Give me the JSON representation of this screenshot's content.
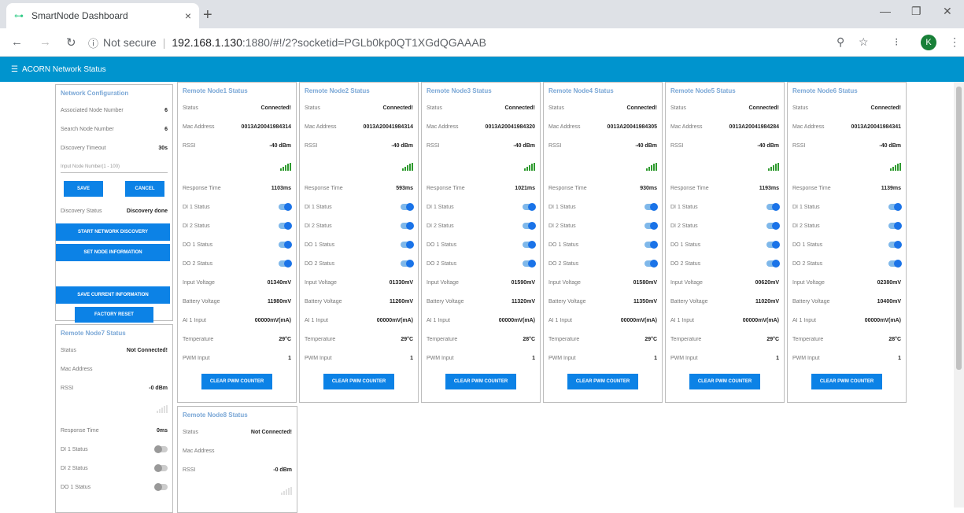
{
  "browser": {
    "tab_title": "SmartNode Dashboard",
    "tab_close": "×",
    "new_tab": "+",
    "not_secure": "Not secure",
    "url_host": "192.168.1.130",
    "url_rest": ":1880/#!/2?socketid=PGLb0kp0QT1XGdQGAAAB",
    "avatar_letter": "K"
  },
  "app": {
    "title": "ACORN Network Status",
    "menu_glyph": "☰"
  },
  "config": {
    "title": "Network Configuration",
    "rows": [
      {
        "label": "Associated Node Number",
        "value": "6"
      },
      {
        "label": "Search Node Number",
        "value": "6"
      },
      {
        "label": "Discovery Timeout",
        "value": "30s"
      }
    ],
    "input_placeholder": "Input Node Number(1 - 100)",
    "save": "SAVE",
    "cancel": "CANCEL",
    "discovery_label": "Discovery Status",
    "discovery_value": "Discovery done",
    "start_discovery": "START NETWORK DISCOVERY",
    "set_node_info": "SET NODE INFORMATION",
    "save_current": "SAVE CURRENT INFORMATION",
    "factory_reset": "FACTORY RESET"
  },
  "labels": {
    "status": "Status",
    "mac": "Mac Address",
    "rssi": "RSSI",
    "response": "Response Time",
    "di1": "DI 1 Status",
    "di2": "DI 2 Status",
    "do1": "DO 1 Status",
    "do2": "DO 2 Status",
    "input_v": "Input Voltage",
    "battery_v": "Battery Voltage",
    "ai1": "AI 1 Input",
    "temp": "Temperature",
    "pwm": "PWM Input",
    "clear_pwm": "CLEAR PWM COUNTER"
  },
  "nodes": [
    {
      "title": "Remote Node1 Status",
      "status": "Connected!",
      "mac": "0013A20041984314",
      "rssi": "-40 dBm",
      "response": "1103ms",
      "input_v": "01340mV",
      "battery_v": "11980mV",
      "ai1": "00000mV(mA)",
      "temp": "29°C",
      "pwm": "1"
    },
    {
      "title": "Remote Node2 Status",
      "status": "Connected!",
      "mac": "0013A20041984314",
      "rssi": "-40 dBm",
      "response": "593ms",
      "input_v": "01330mV",
      "battery_v": "11260mV",
      "ai1": "00000mV(mA)",
      "temp": "29°C",
      "pwm": "1"
    },
    {
      "title": "Remote Node3 Status",
      "status": "Connected!",
      "mac": "0013A20041984320",
      "rssi": "-40 dBm",
      "response": "1021ms",
      "input_v": "01590mV",
      "battery_v": "11320mV",
      "ai1": "00000mV(mA)",
      "temp": "28°C",
      "pwm": "1"
    },
    {
      "title": "Remote Node4 Status",
      "status": "Connected!",
      "mac": "0013A20041984305",
      "rssi": "-40 dBm",
      "response": "930ms",
      "input_v": "01580mV",
      "battery_v": "11350mV",
      "ai1": "00000mV(mA)",
      "temp": "29°C",
      "pwm": "1"
    },
    {
      "title": "Remote Node5 Status",
      "status": "Connected!",
      "mac": "0013A20041984284",
      "rssi": "-40 dBm",
      "response": "1193ms",
      "input_v": "00620mV",
      "battery_v": "11020mV",
      "ai1": "00000mV(mA)",
      "temp": "29°C",
      "pwm": "1"
    },
    {
      "title": "Remote Node6 Status",
      "status": "Connected!",
      "mac": "0013A20041984341",
      "rssi": "-40 dBm",
      "response": "1139ms",
      "input_v": "02380mV",
      "battery_v": "10400mV",
      "ai1": "00000mV(mA)",
      "temp": "28°C",
      "pwm": "1"
    }
  ],
  "node7": {
    "title": "Remote Node7 Status",
    "status": "Not Connected!",
    "mac": "",
    "rssi": "-0 dBm",
    "response": "0ms"
  },
  "node8": {
    "title": "Remote Node8 Status",
    "status": "Not Connected!",
    "mac": "",
    "rssi": "-0 dBm"
  }
}
